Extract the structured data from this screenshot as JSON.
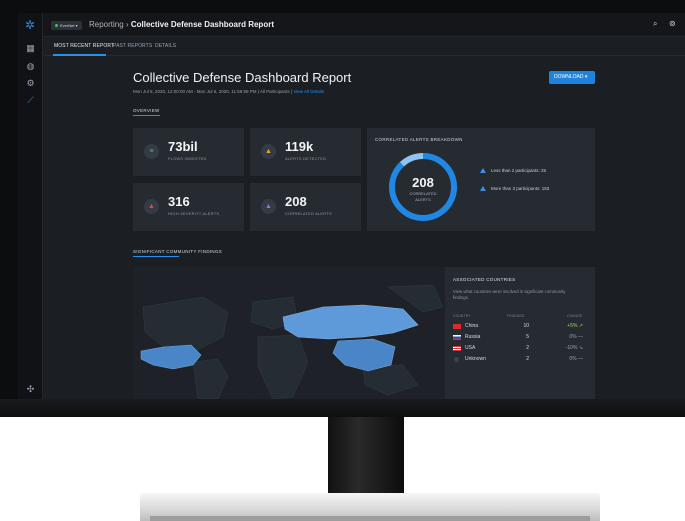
{
  "topbar": {
    "org": "EverNet",
    "breadcrumb_root": "Reporting",
    "breadcrumb_sep": "›",
    "breadcrumb_current": "Collective Defense Dashboard Report",
    "search_icon": "search-icon",
    "help_icon": "help-icon"
  },
  "tabs": [
    "MOST RECENT REPORT",
    "PAST REPORTS",
    "DETAILS"
  ],
  "header": {
    "title": "Collective Defense Dashboard Report",
    "subtitle": "Mon Jul 6, 2020, 12:00:00 AM - Mon Jul 6, 2020, 11:59:59 PM  |  All Participants  |",
    "view_link": "View All Details",
    "download_label": "DOWNLOAD"
  },
  "overview": {
    "label": "OVERVIEW",
    "stats": [
      {
        "value": "73bil",
        "label": "FLOWS INGESTED",
        "color": "#3bbf6e",
        "icon": "database-icon"
      },
      {
        "value": "119k",
        "label": "ALERTS DETECTED",
        "color": "#f0a030",
        "icon": "warning-icon"
      },
      {
        "value": "316",
        "label": "HIGH SEVERITY ALERTS",
        "color": "#e8434b",
        "icon": "warning-icon"
      },
      {
        "value": "208",
        "label": "CORRELATED ALERTS",
        "color": "#7b7fd6",
        "icon": "warning-icon"
      }
    ],
    "breakdown": {
      "title": "CORRELATED ALERTS BREAKDOWN",
      "total": "208",
      "total_label_1": "CORRELATED",
      "total_label_2": "ALERTS",
      "items": [
        {
          "label": "Less than 2 participants: 25",
          "value": 25
        },
        {
          "label": "More than 3 participants: 183",
          "value": 183
        }
      ],
      "colors": {
        "main": "#1f88e5",
        "minor": "#8fc3f2"
      }
    }
  },
  "findings": {
    "label": "SIGNIFICANT COMMUNITY FINDINGS",
    "panel_title": "ASSOCIATED COUNTRIES",
    "panel_desc": "View what countries were involved in significant community findings.",
    "columns": [
      "COUNTRY",
      "FINDINGS",
      "CHANGE"
    ],
    "rows": [
      {
        "country": "China",
        "findings": "10",
        "change": "+5% ↗"
      },
      {
        "country": "Russia",
        "findings": "5",
        "change": "0% —"
      },
      {
        "country": "USA",
        "findings": "2",
        "change": "-10% ↘"
      },
      {
        "country": "Unknown",
        "findings": "2",
        "change": "0% —"
      }
    ]
  }
}
